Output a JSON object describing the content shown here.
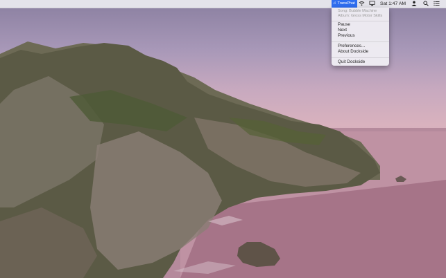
{
  "menubar": {
    "app_name": "TransPhat",
    "clock": "Sat 1:47 AM",
    "icons": [
      "transphat-icon",
      "wifi-icon",
      "airplay-icon",
      "user-icon",
      "search-icon",
      "notification-center-icon"
    ]
  },
  "dropdown": {
    "song": "Song: Bubble Machine",
    "album": "Album: Gross Motor Skills",
    "items": {
      "pause": "Pause",
      "next": "Next",
      "previous": "Previous",
      "preferences": "Preferences...",
      "about": "About Dockside",
      "quit": "Quit Dockside"
    }
  },
  "colors": {
    "accent": "#2f6ef0",
    "menu_bg": "#f0eef3",
    "disabled_text": "#9b9b9b"
  }
}
